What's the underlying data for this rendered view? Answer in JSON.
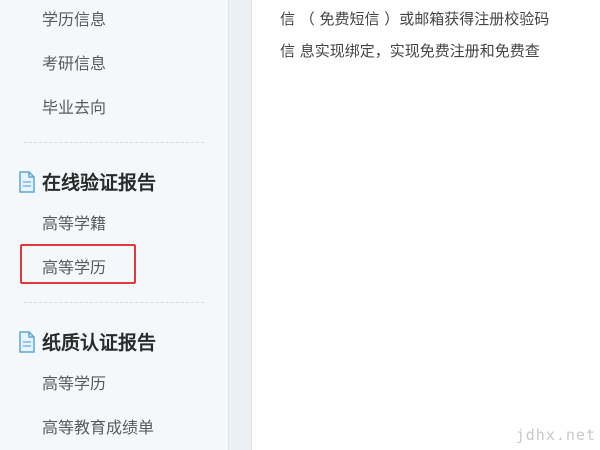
{
  "sidebar": {
    "top_links": [
      "学历信息",
      "考研信息",
      "毕业去向"
    ],
    "sections": [
      {
        "title": "在线验证报告",
        "items": [
          "高等学籍",
          "高等学历"
        ]
      },
      {
        "title": "纸质认证报告",
        "items": [
          "高等学历",
          "高等教育成绩单"
        ]
      }
    ],
    "highlighted_item": "高等学历",
    "highlight_color": "#e4393c"
  },
  "main": {
    "lines": [
      "信 （ 免费短信 ）或邮箱获得注册校验码",
      "信 息实现绑定，实现免费注册和免费查"
    ]
  },
  "watermark": "jdhx.net"
}
